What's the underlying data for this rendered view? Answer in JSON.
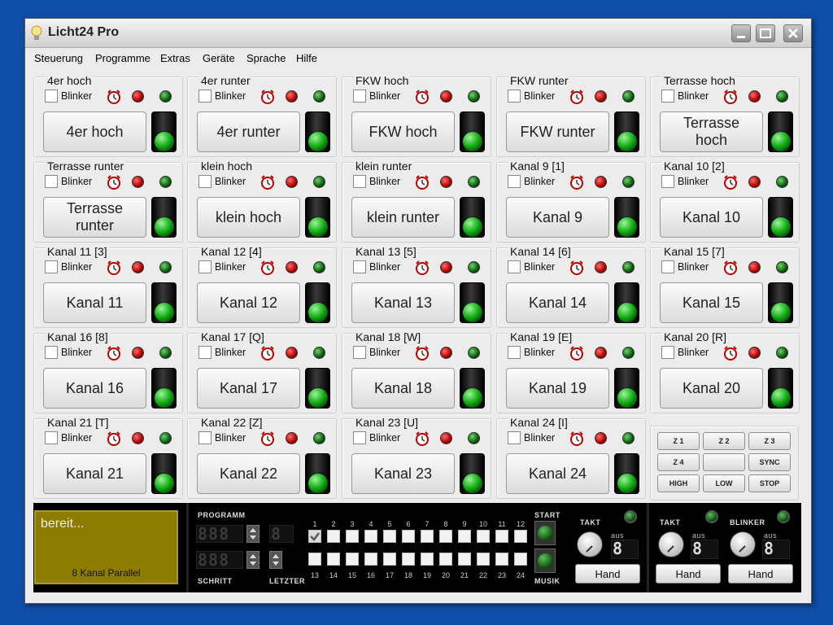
{
  "window": {
    "title": "Licht24 Pro"
  },
  "menu": [
    "Steuerung",
    "Programme",
    "Extras",
    "Geräte",
    "Sprache",
    "Hilfe"
  ],
  "blinker_label": "Blinker",
  "channels": [
    {
      "title": "4er hoch",
      "button": "4er hoch"
    },
    {
      "title": "4er runter",
      "button": "4er runter"
    },
    {
      "title": "FKW hoch",
      "button": "FKW hoch"
    },
    {
      "title": "FKW runter",
      "button": "FKW runter"
    },
    {
      "title": "Terrasse hoch",
      "button": "Terrasse hoch"
    },
    {
      "title": "Terrasse runter",
      "button": "Terrasse runter"
    },
    {
      "title": "klein hoch",
      "button": "klein hoch"
    },
    {
      "title": "klein runter",
      "button": "klein runter"
    },
    {
      "title": "Kanal 9 [1]",
      "button": "Kanal 9"
    },
    {
      "title": "Kanal 10 [2]",
      "button": "Kanal 10"
    },
    {
      "title": "Kanal 11 [3]",
      "button": "Kanal 11"
    },
    {
      "title": "Kanal 12 [4]",
      "button": "Kanal 12"
    },
    {
      "title": "Kanal 13 [5]",
      "button": "Kanal 13"
    },
    {
      "title": "Kanal 14 [6]",
      "button": "Kanal 14"
    },
    {
      "title": "Kanal 15 [7]",
      "button": "Kanal 15"
    },
    {
      "title": "Kanal 16 [8]",
      "button": "Kanal 16"
    },
    {
      "title": "Kanal 17 [Q]",
      "button": "Kanal 17"
    },
    {
      "title": "Kanal 18 [W]",
      "button": "Kanal 18"
    },
    {
      "title": "Kanal 19 [E]",
      "button": "Kanal 19"
    },
    {
      "title": "Kanal 20 [R]",
      "button": "Kanal 20"
    },
    {
      "title": "Kanal 21 [T]",
      "button": "Kanal 21"
    },
    {
      "title": "Kanal 22 [Z]",
      "button": "Kanal 22"
    },
    {
      "title": "Kanal 23 [U]",
      "button": "Kanal 23"
    },
    {
      "title": "Kanal 24 [I]",
      "button": "Kanal 24"
    }
  ],
  "zone_buttons": [
    "Z 1",
    "Z 2",
    "Z 3",
    "Z 4",
    "",
    "SYNC",
    "HIGH",
    "LOW",
    "STOP"
  ],
  "status": {
    "text": "bereit...",
    "mode": "8 Kanal Parallel"
  },
  "programm": {
    "label": "PROGRAMM",
    "display": "888",
    "digit": "8"
  },
  "schritt": {
    "label": "SCHRITT",
    "display": "888"
  },
  "letzter_label": "LETZTER",
  "steps_top": [
    "1",
    "2",
    "3",
    "4",
    "5",
    "6",
    "7",
    "8",
    "9",
    "10",
    "11",
    "12"
  ],
  "steps_bottom": [
    "13",
    "14",
    "15",
    "16",
    "17",
    "18",
    "19",
    "20",
    "21",
    "22",
    "23",
    "24"
  ],
  "start_label": "START",
  "musik_label": "MUSIK",
  "takt_label": "TAKT",
  "aus_label": "aus",
  "blinker_section_label": "BLINKER",
  "aus_display": "8",
  "hand_label": "Hand",
  "colors": {
    "desktop": "#0f4fa8",
    "status_bg": "#8c7c00",
    "led_green": "#17b217",
    "led_red": "#b00000"
  }
}
